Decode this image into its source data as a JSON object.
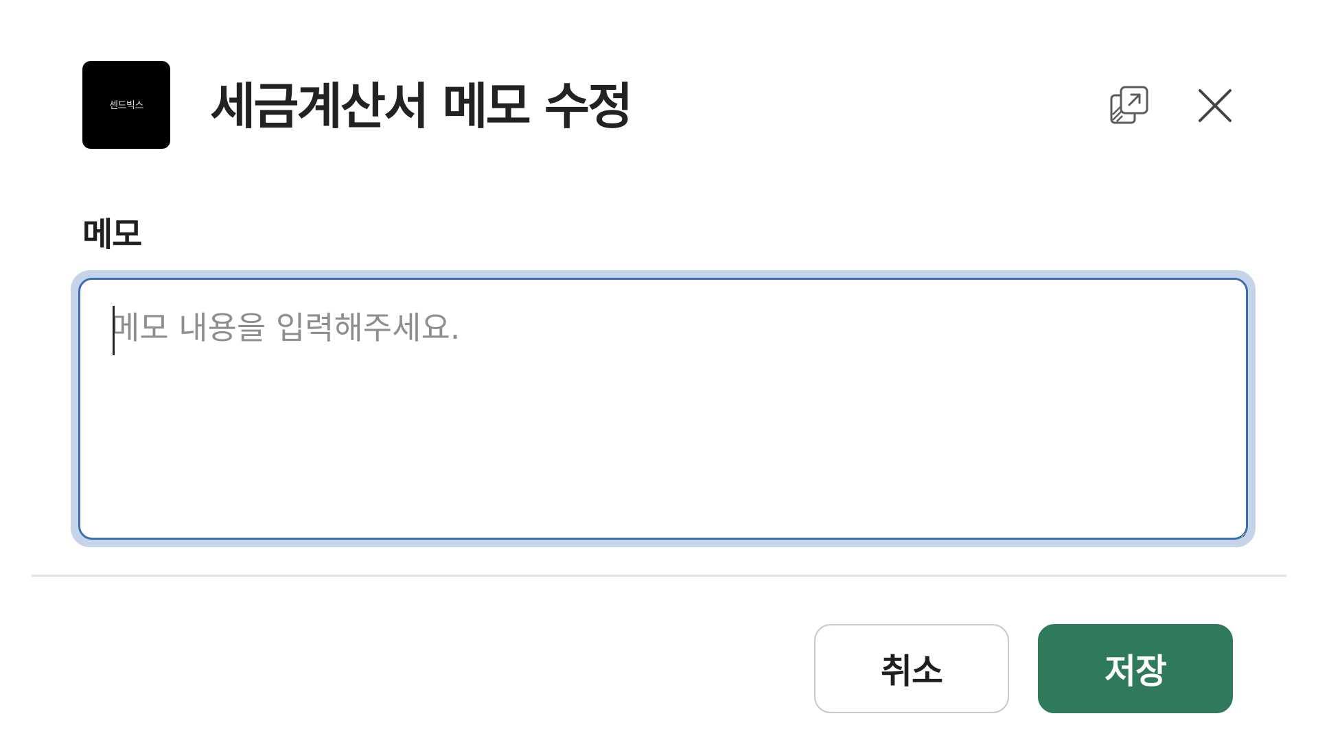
{
  "header": {
    "logo_text": "센드빅스",
    "title": "세금계산서 메모 수정",
    "icons": {
      "popout": "open-in-new-window-icon",
      "close": "close-icon"
    }
  },
  "form": {
    "memo_label": "메모",
    "memo_value": "",
    "memo_placeholder": "메모 내용을 입력해주세요."
  },
  "footer": {
    "cancel_label": "취소",
    "save_label": "저장"
  },
  "colors": {
    "primary": "#2e7a5a",
    "focus_border": "#3b6db3",
    "focus_ring": "#c5d4e8"
  }
}
